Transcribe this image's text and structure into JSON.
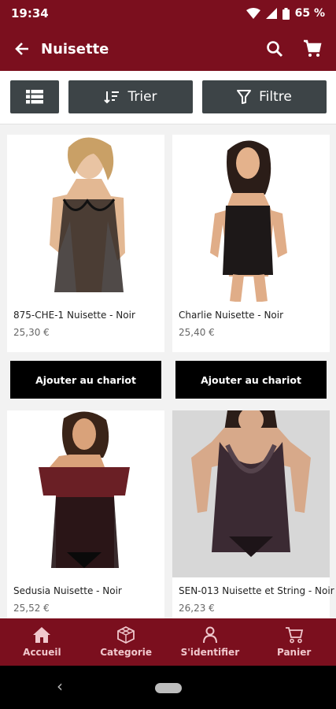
{
  "status": {
    "time": "19:34",
    "battery": "65 %"
  },
  "app_bar": {
    "title": "Nuisette"
  },
  "toolbar": {
    "sort_label": "Trier",
    "filter_label": "Filtre"
  },
  "products": [
    {
      "name": "875-CHE-1 Nuisette - Noir",
      "price": "25,30 €",
      "add_label": "Ajouter au chariot"
    },
    {
      "name": "Charlie Nuisette - Noir",
      "price": "25,40 €",
      "add_label": "Ajouter au chariot"
    },
    {
      "name": "Sedusia Nuisette - Noir",
      "price": "25,52 €"
    },
    {
      "name": "SEN-013 Nuisette et String - Noir",
      "price": "26,23 €"
    }
  ],
  "bottom_nav": [
    {
      "label": "Accueil",
      "icon": "home-icon"
    },
    {
      "label": "Categorie",
      "icon": "cube-icon"
    },
    {
      "label": "S'identifier",
      "icon": "user-icon"
    },
    {
      "label": "Panier",
      "icon": "cart-icon"
    }
  ],
  "colors": {
    "brand": "#7b0f1e",
    "toolbar_button": "#3d4447",
    "add_button": "#000000"
  }
}
